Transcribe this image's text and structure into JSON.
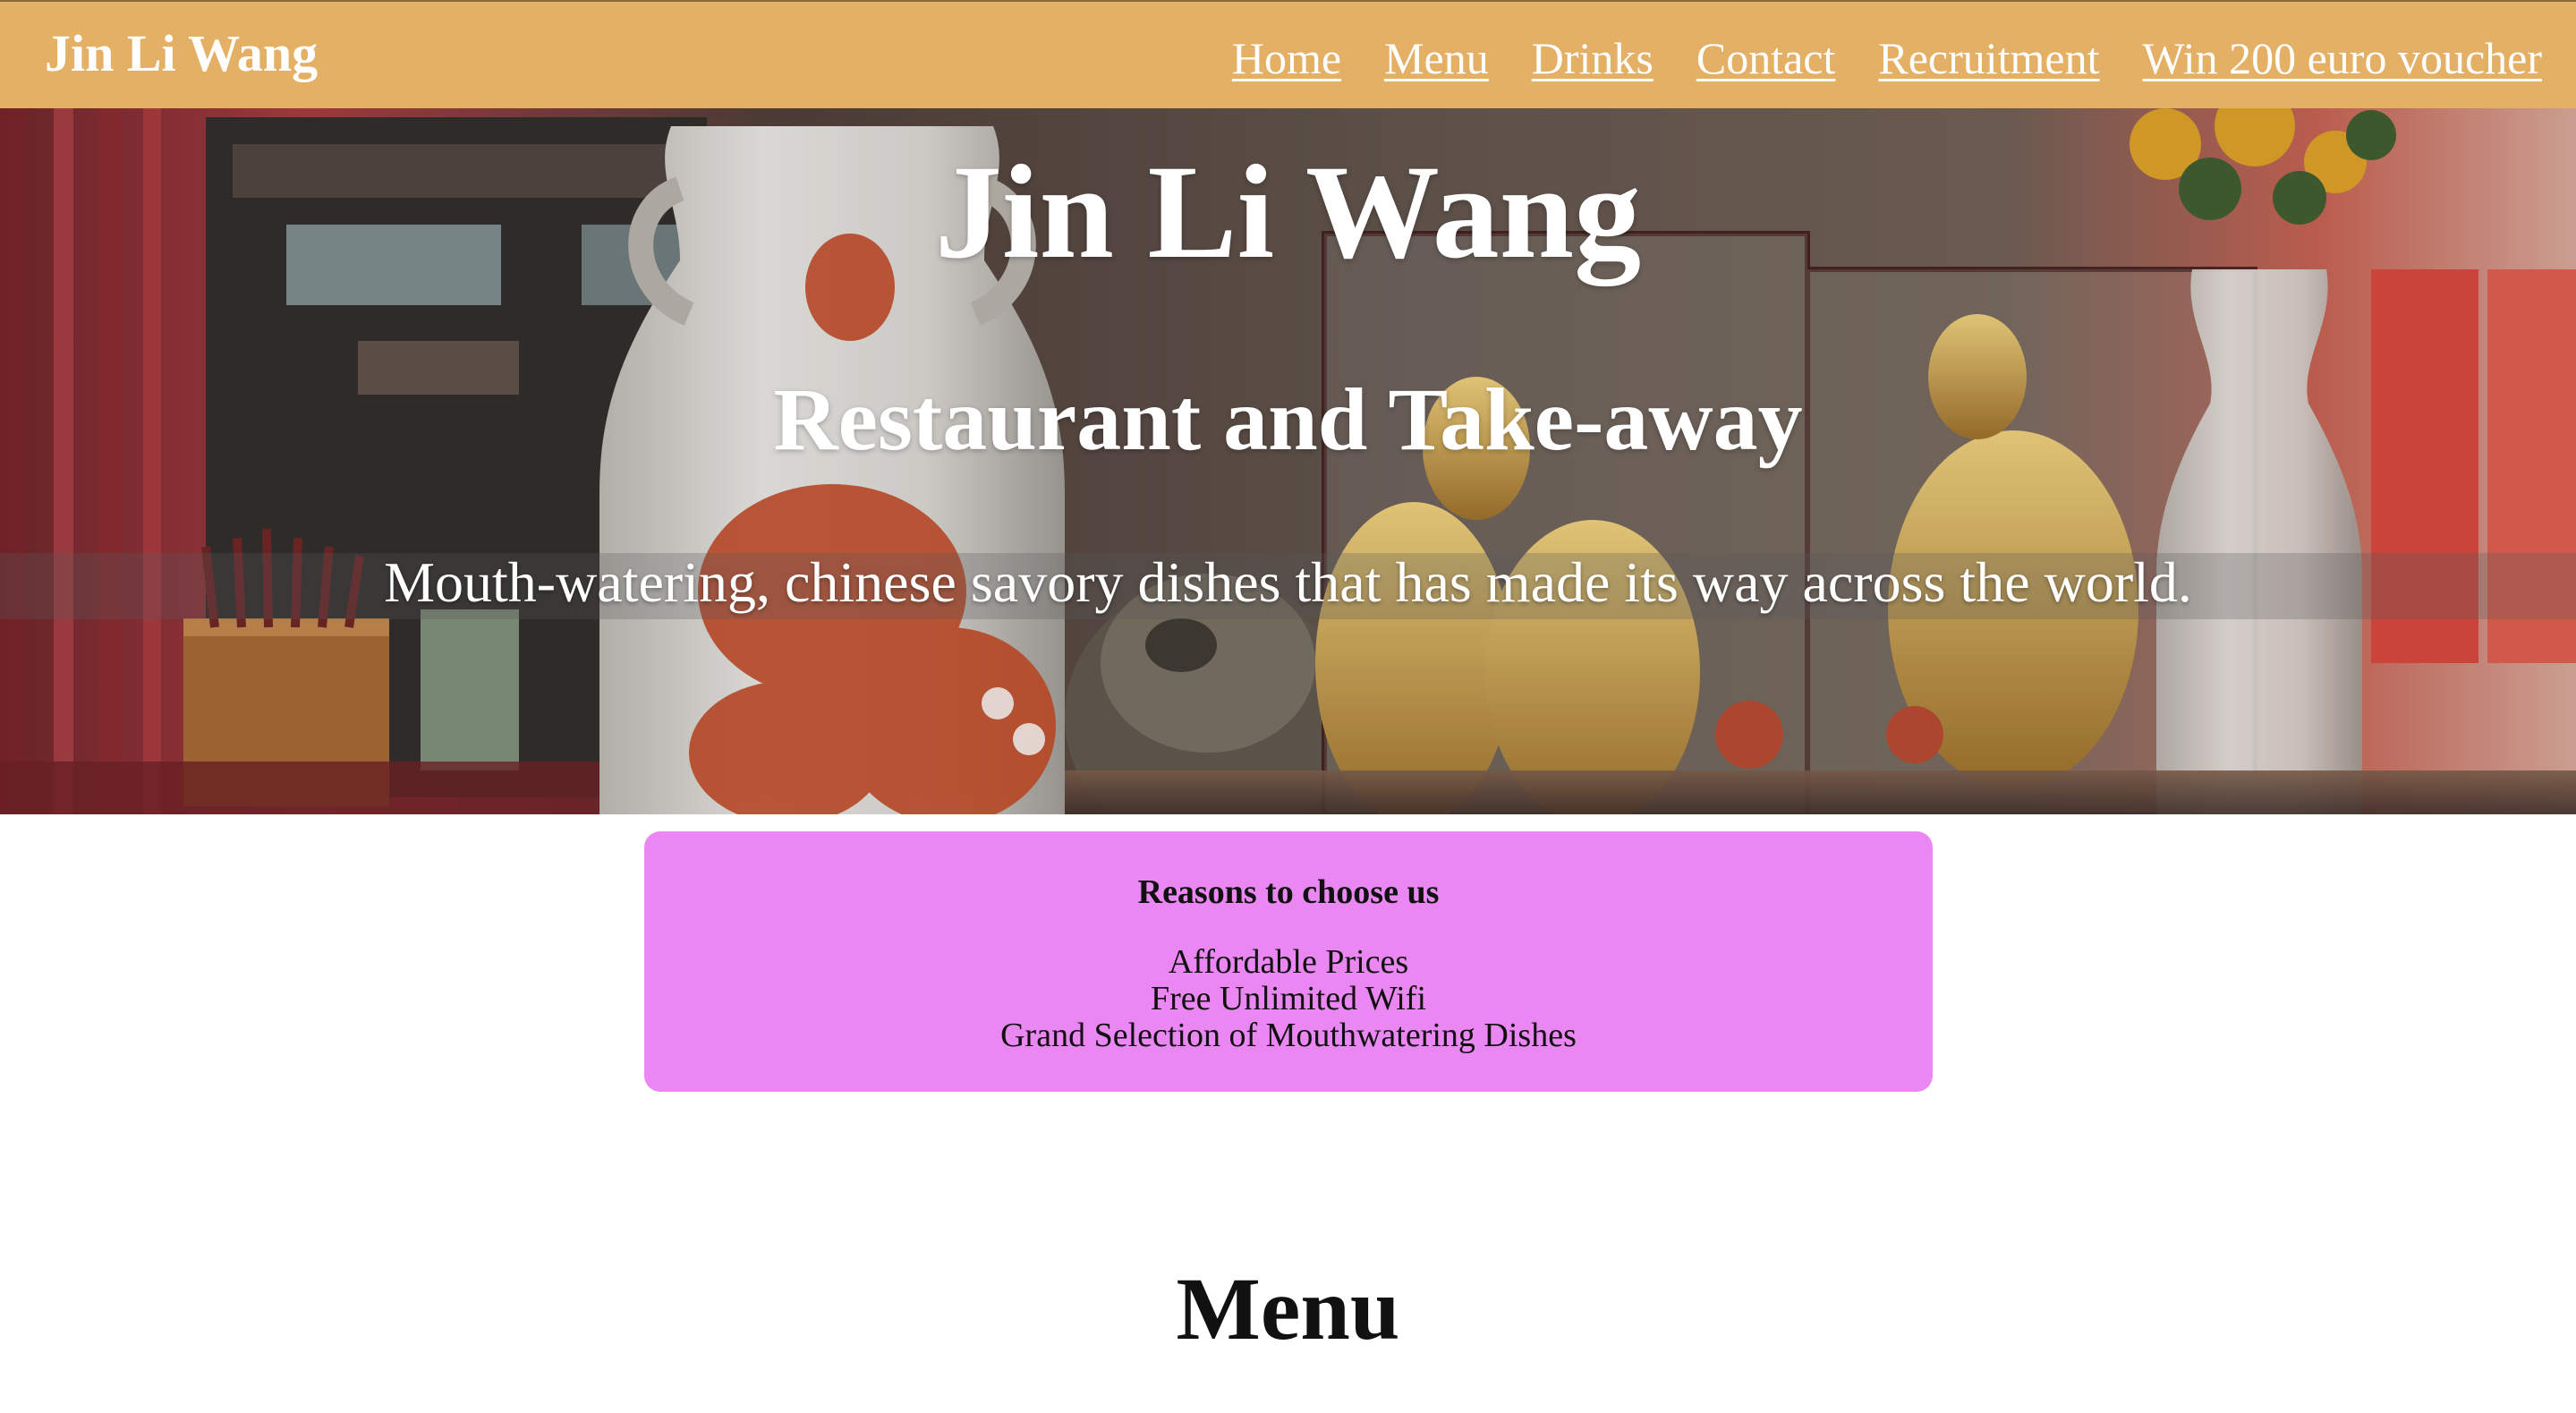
{
  "nav": {
    "brand": "Jin Li Wang",
    "links": [
      "Home",
      "Menu",
      "Drinks",
      "Contact",
      "Recruitment",
      "Win 200 euro voucher"
    ]
  },
  "hero": {
    "title": "Jin Li Wang",
    "subtitle": "Restaurant and Take-away",
    "tagline": "Mouth-watering, chinese savory dishes that has made its way across the world."
  },
  "reasons": {
    "heading": "Reasons to choose us",
    "items": [
      "Affordable Prices",
      "Free Unlimited Wifi",
      "Grand Selection of Mouthwatering Dishes"
    ]
  },
  "menu_section": {
    "heading": "Menu"
  },
  "colors": {
    "nav_bg": "#e3b066",
    "reasons_bg": "#ea87f2",
    "text_light": "#ffffff",
    "text_dark": "#111111"
  }
}
